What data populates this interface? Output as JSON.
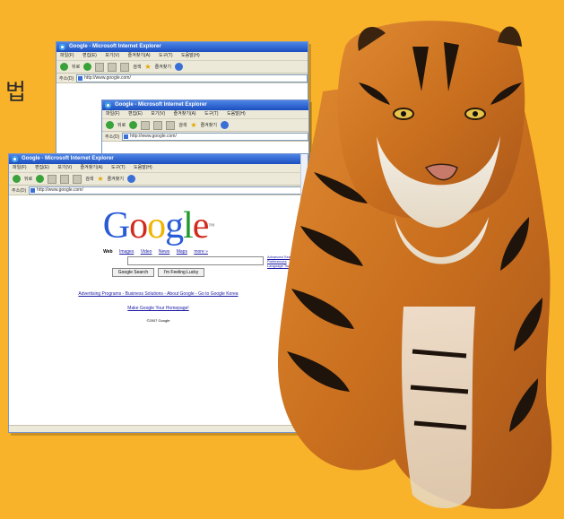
{
  "side_text": "법",
  "windows": [
    {
      "title": "Google - Microsoft Internet Explorer",
      "menu": [
        "파일(F)",
        "편집(E)",
        "보기(V)",
        "즐겨찾기(A)",
        "도구(T)",
        "도움말(H)"
      ],
      "toolbar": {
        "back": "뒤로",
        "search": "검색",
        "favorites": "즐겨찾기"
      },
      "address_label": "주소(D)",
      "url": "http://www.google.com/"
    },
    {
      "title": "Google - Microsoft Internet Explorer",
      "menu": [
        "파일(F)",
        "편집(E)",
        "보기(V)",
        "즐겨찾기(A)",
        "도구(T)",
        "도움말(H)"
      ],
      "toolbar": {
        "back": "뒤로",
        "search": "검색",
        "favorites": "즐겨찾기"
      },
      "address_label": "주소(D)",
      "url": "http://www.google.com/"
    },
    {
      "title": "Google - Microsoft Internet Explorer",
      "menu": [
        "파일(F)",
        "편집(E)",
        "보기(V)",
        "즐겨찾기(A)",
        "도구(T)",
        "도움말(H)"
      ],
      "toolbar": {
        "back": "뒤로",
        "search": "검색",
        "favorites": "즐겨찾기"
      },
      "address_label": "주소(D)",
      "url": "http://www.google.com/"
    }
  ],
  "google": {
    "logo": "Google",
    "tabs": {
      "active": "Web",
      "others": [
        "Images",
        "Video",
        "News",
        "Maps",
        "more »"
      ]
    },
    "side_links": [
      "Advanced Search",
      "Preferences",
      "Language Tools"
    ],
    "search_button": "Google Search",
    "lucky_button": "I'm Feeling Lucky",
    "footer_links": "Advertising Programs - Business Solutions - About Google - Go to Google Korea",
    "homepage_link": "Make Google Your Homepage!",
    "copyright": "©2007 Google"
  },
  "colors": {
    "background": "#f8b32a",
    "ie_titlebar": "#1c4fbf",
    "link_blue": "#1a1aa6"
  }
}
